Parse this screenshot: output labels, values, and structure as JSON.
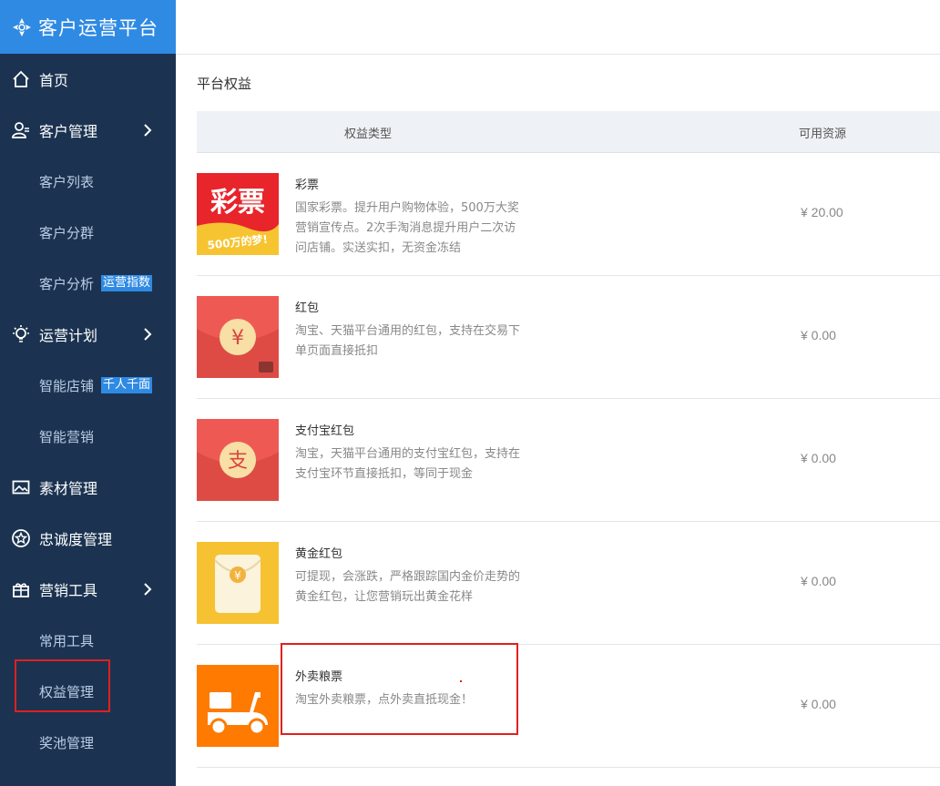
{
  "brand": {
    "title": "客户运营平台",
    "logo_icon": "platform-logo-icon"
  },
  "sidebar": {
    "items": [
      {
        "label": "首页",
        "icon": "home-icon",
        "level": "top"
      },
      {
        "label": "客户管理",
        "icon": "customers-icon",
        "level": "top",
        "expand_arrow": true
      },
      {
        "label": "客户列表",
        "level": "sub"
      },
      {
        "label": "客户分群",
        "level": "sub"
      },
      {
        "label": "客户分析",
        "level": "sub",
        "badge": "运营指数"
      },
      {
        "label": "运营计划",
        "icon": "bulb-icon",
        "level": "top",
        "expand_arrow": true
      },
      {
        "label": "智能店铺",
        "level": "sub",
        "badge": "千人千面"
      },
      {
        "label": "智能营销",
        "level": "sub"
      },
      {
        "label": "素材管理",
        "icon": "image-icon",
        "level": "top"
      },
      {
        "label": "忠诚度管理",
        "icon": "star-circle-icon",
        "level": "top"
      },
      {
        "label": "营销工具",
        "icon": "gift-icon",
        "level": "top",
        "expand_arrow": true
      },
      {
        "label": "常用工具",
        "level": "sub"
      },
      {
        "label": "权益管理",
        "level": "sub",
        "selected": true
      },
      {
        "label": "奖池管理",
        "level": "sub"
      }
    ]
  },
  "main": {
    "title": "平台权益",
    "table": {
      "headers": {
        "type": "权益类型",
        "resource": "可用资源"
      },
      "rows": [
        {
          "name": "彩票",
          "desc": "国家彩票。提升用户购物体验，500万大奖营销宣传点。2次手淘消息提升用户二次访问店铺。实送实扣，无资金冻结",
          "price": "¥ 20.00",
          "image": "lottery-image",
          "image_text": "彩票",
          "image_subtext": "500万的梦!"
        },
        {
          "name": "红包",
          "desc": "淘宝、天猫平台通用的红包，支持在交易下单页面直接抵扣",
          "price": "¥ 0.00",
          "image": "red-envelope-image",
          "image_text": "¥"
        },
        {
          "name": "支付宝红包",
          "desc": "淘宝，天猫平台通用的支付宝红包，支持在支付宝环节直接抵扣，等同于现金",
          "price": "¥ 0.00",
          "image": "alipay-envelope-image",
          "image_text": "支"
        },
        {
          "name": "黄金红包",
          "desc": "可提现，会涨跌，严格跟踪国内金价走势的黄金红包，让您营销玩出黄金花样",
          "price": "¥ 0.00",
          "image": "gold-envelope-image",
          "image_text": "¥"
        },
        {
          "name": "外卖粮票",
          "desc": "淘宝外卖粮票，点外卖直抵现金！",
          "price": "¥ 0.00",
          "image": "scooter-image"
        }
      ]
    }
  },
  "colors": {
    "sidebar_bg": "#1b3350",
    "brand_bg": "#2f8ae3",
    "badge_bg": "#2f8ae3",
    "highlight_red": "#e02020"
  }
}
